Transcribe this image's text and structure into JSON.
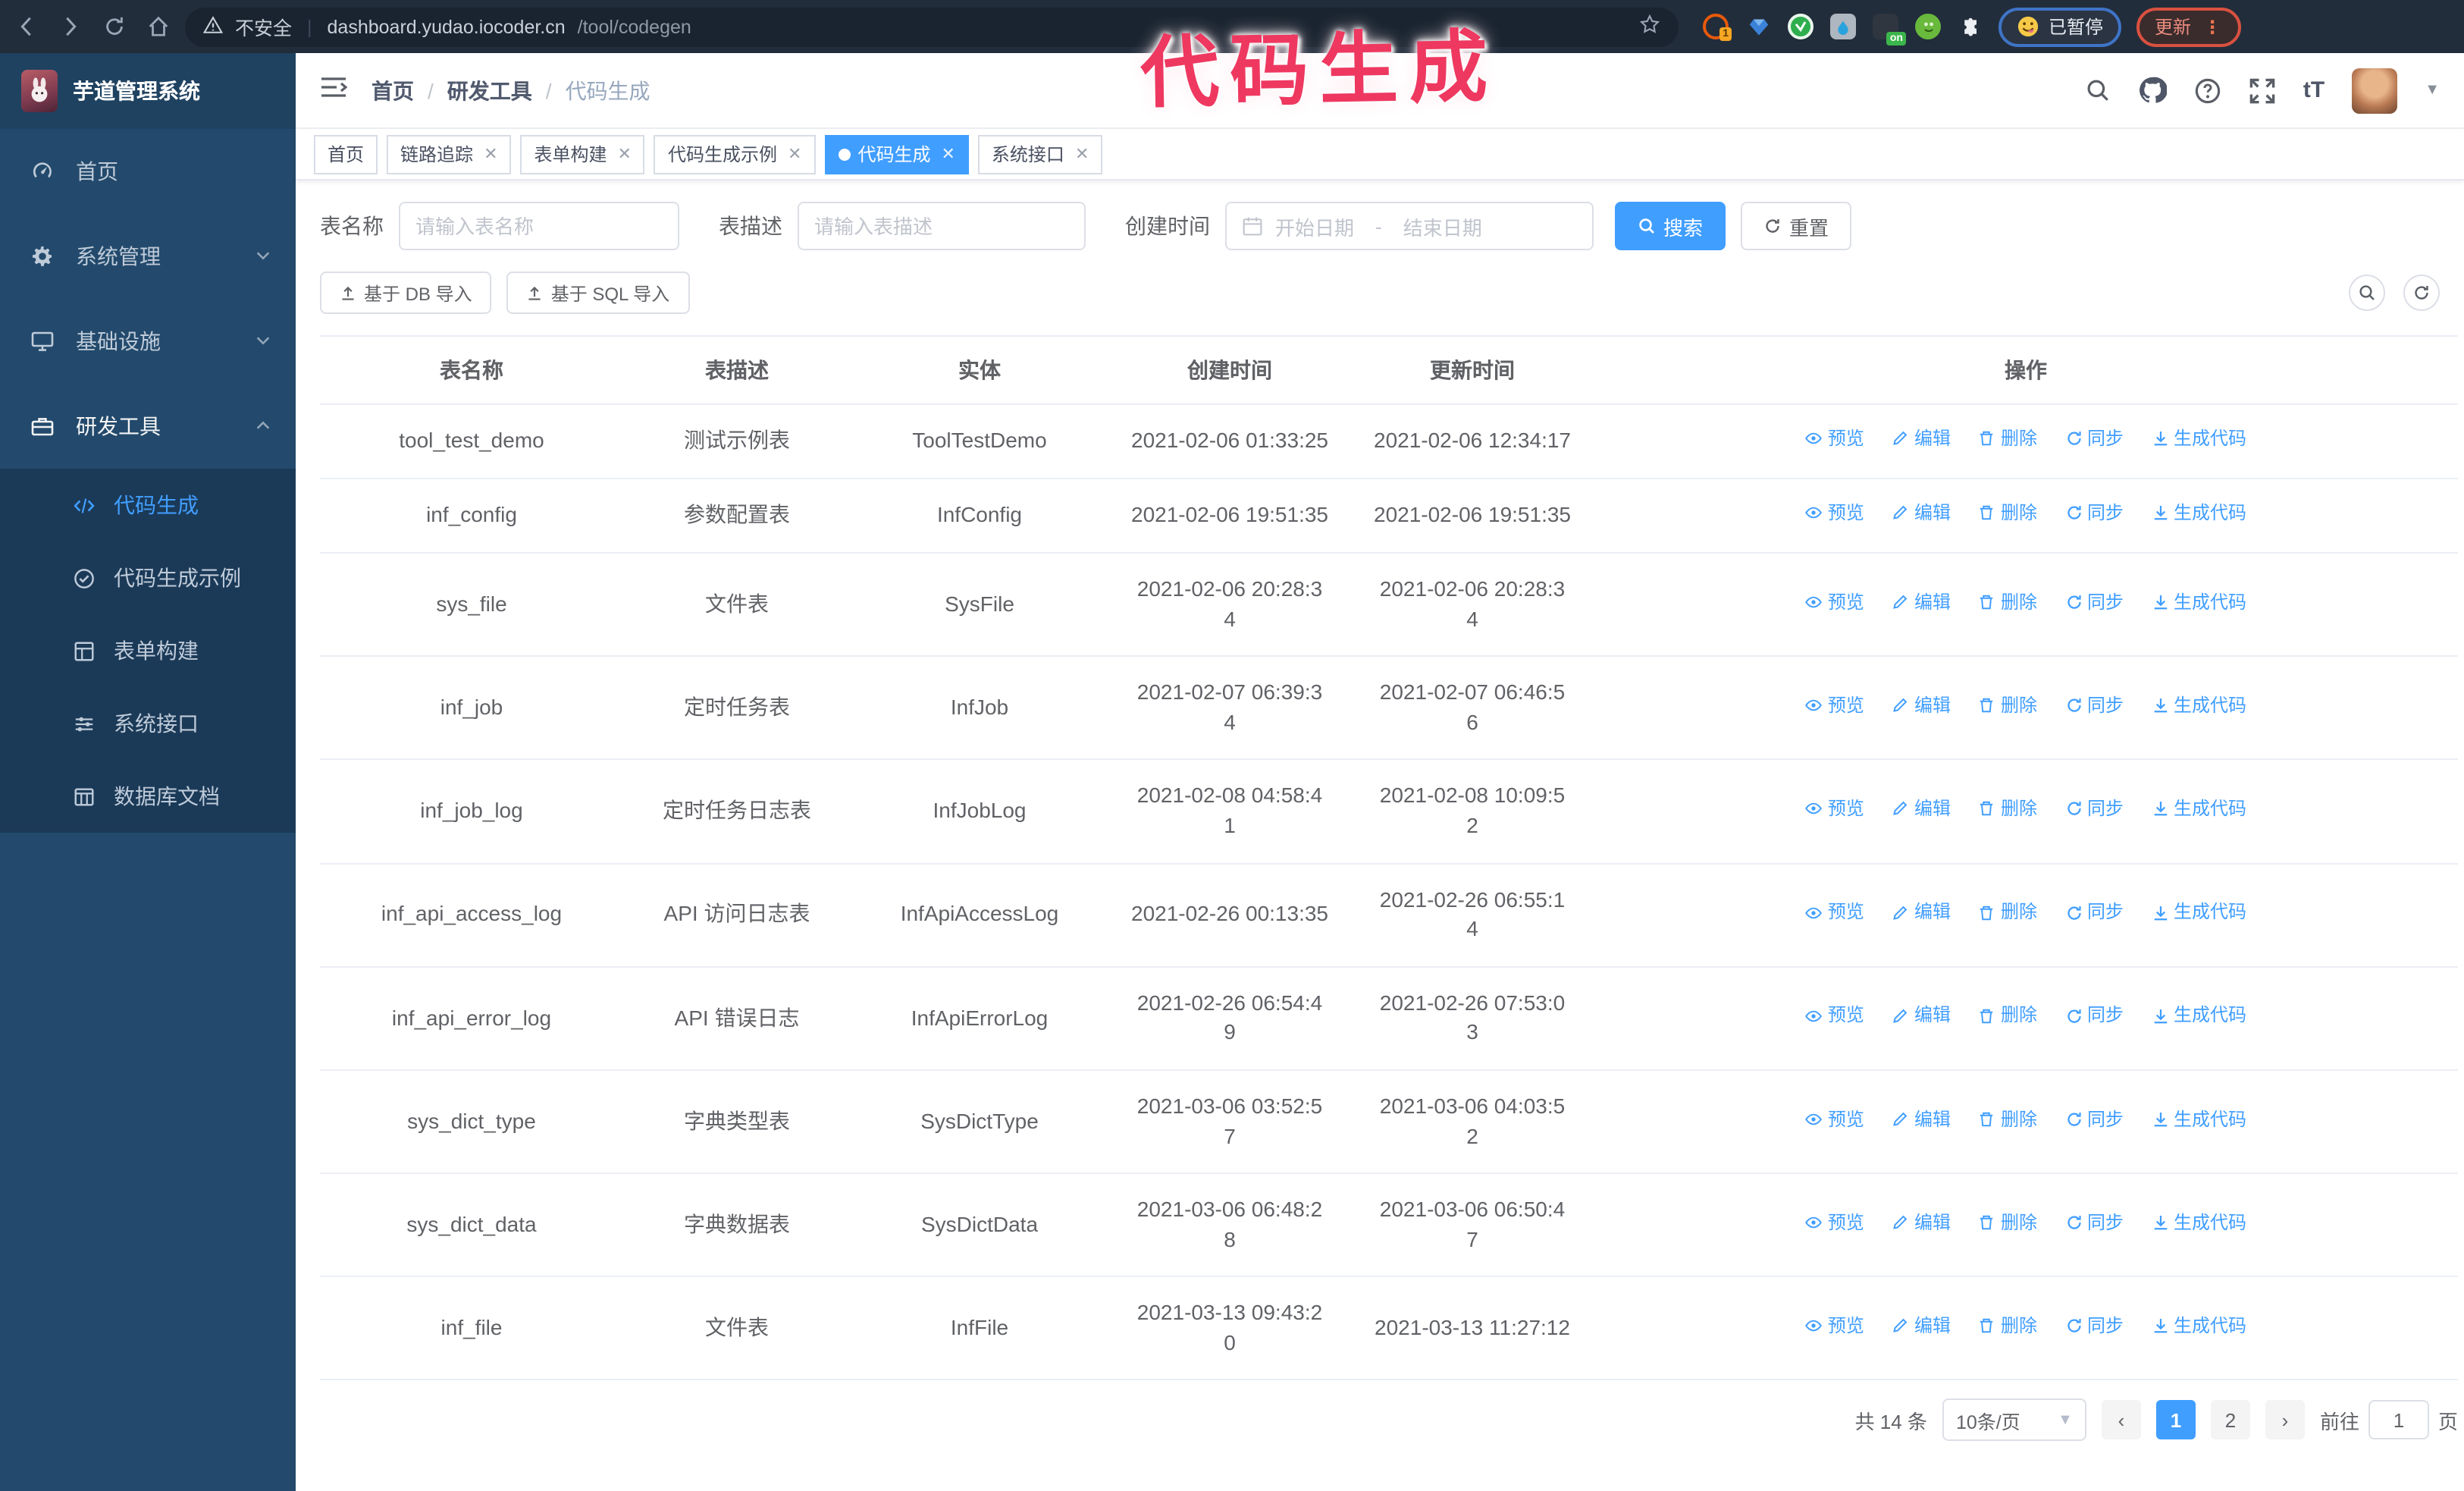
{
  "browser": {
    "security_label": "不安全",
    "url_host": "dashboard.yudao.iocoder.cn",
    "url_path": "/tool/codegen",
    "url_separator": "|",
    "extension_badge": "1",
    "extension_on_badge": "on",
    "paused_badge": "已暂停",
    "update_button": "更新",
    "menu_dots": "⋮"
  },
  "annotation": {
    "text": "代码生成",
    "color": "#ee3860"
  },
  "sidebar": {
    "logo_title": "芋道管理系统",
    "items": [
      {
        "label": "首页"
      },
      {
        "label": "系统管理"
      },
      {
        "label": "基础设施"
      },
      {
        "label": "研发工具"
      }
    ],
    "submenu": [
      {
        "label": "代码生成"
      },
      {
        "label": "代码生成示例"
      },
      {
        "label": "表单构建"
      },
      {
        "label": "系统接口"
      },
      {
        "label": "数据库文档"
      }
    ]
  },
  "header": {
    "breadcrumb": {
      "items": [
        "首页",
        "研发工具",
        "代码生成"
      ],
      "separator": "/"
    },
    "font_size_icon_text": "tT"
  },
  "tabs": [
    {
      "label": "首页"
    },
    {
      "label": "链路追踪"
    },
    {
      "label": "表单构建"
    },
    {
      "label": "代码生成示例"
    },
    {
      "label": "代码生成"
    },
    {
      "label": "系统接口"
    }
  ],
  "filters": {
    "table_name_label": "表名称",
    "table_name_placeholder": "请输入表名称",
    "table_desc_label": "表描述",
    "table_desc_placeholder": "请输入表描述",
    "create_time_label": "创建时间",
    "date_start_placeholder": "开始日期",
    "date_separator": "-",
    "date_end_placeholder": "结束日期",
    "search_button": "搜索",
    "reset_button": "重置"
  },
  "toolbar": {
    "import_db_button": "基于 DB 导入",
    "import_sql_button": "基于 SQL 导入"
  },
  "table": {
    "columns": [
      "表名称",
      "表描述",
      "实体",
      "创建时间",
      "更新时间",
      "操作"
    ],
    "actions": [
      "预览",
      "编辑",
      "删除",
      "同步",
      "生成代码"
    ],
    "rows": [
      {
        "name": "tool_test_demo",
        "desc": "测试示例表",
        "entity": "ToolTestDemo",
        "created": "2021-02-06 01:33:25",
        "updated": "2021-02-06 12:34:17"
      },
      {
        "name": "inf_config",
        "desc": "参数配置表",
        "entity": "InfConfig",
        "created": "2021-02-06 19:51:35",
        "updated": "2021-02-06 19:51:35"
      },
      {
        "name": "sys_file",
        "desc": "文件表",
        "entity": "SysFile",
        "created": "2021-02-06 20:28:3\n4",
        "updated": "2021-02-06 20:28:3\n4"
      },
      {
        "name": "inf_job",
        "desc": "定时任务表",
        "entity": "InfJob",
        "created": "2021-02-07 06:39:3\n4",
        "updated": "2021-02-07 06:46:5\n6"
      },
      {
        "name": "inf_job_log",
        "desc": "定时任务日志表",
        "entity": "InfJobLog",
        "created": "2021-02-08 04:58:4\n1",
        "updated": "2021-02-08 10:09:5\n2"
      },
      {
        "name": "inf_api_access_log",
        "desc": "API 访问日志表",
        "entity": "InfApiAccessLog",
        "created": "2021-02-26 00:13:35",
        "updated": "2021-02-26 06:55:1\n4"
      },
      {
        "name": "inf_api_error_log",
        "desc": "API 错误日志",
        "entity": "InfApiErrorLog",
        "created": "2021-02-26 06:54:4\n9",
        "updated": "2021-02-26 07:53:0\n3"
      },
      {
        "name": "sys_dict_type",
        "desc": "字典类型表",
        "entity": "SysDictType",
        "created": "2021-03-06 03:52:5\n7",
        "updated": "2021-03-06 04:03:5\n2"
      },
      {
        "name": "sys_dict_data",
        "desc": "字典数据表",
        "entity": "SysDictData",
        "created": "2021-03-06 06:48:2\n8",
        "updated": "2021-03-06 06:50:4\n7"
      },
      {
        "name": "inf_file",
        "desc": "文件表",
        "entity": "InfFile",
        "created": "2021-03-13 09:43:2\n0",
        "updated": "2021-03-13 11:27:12"
      }
    ]
  },
  "pagination": {
    "total": "共 14 条",
    "page_size": "10条/页",
    "pages": [
      "1",
      "2"
    ],
    "active_page": "1",
    "goto_label": "前往",
    "goto_value": "1",
    "goto_suffix": "页"
  },
  "colors": {
    "accent": "#409eff",
    "sidebar_bg": "#234a6c",
    "submenu_bg": "#1b3a58",
    "browser_bar_bg": "#222d3b",
    "annotation": "#ee3860",
    "active_tag_bg": "#409eff"
  }
}
